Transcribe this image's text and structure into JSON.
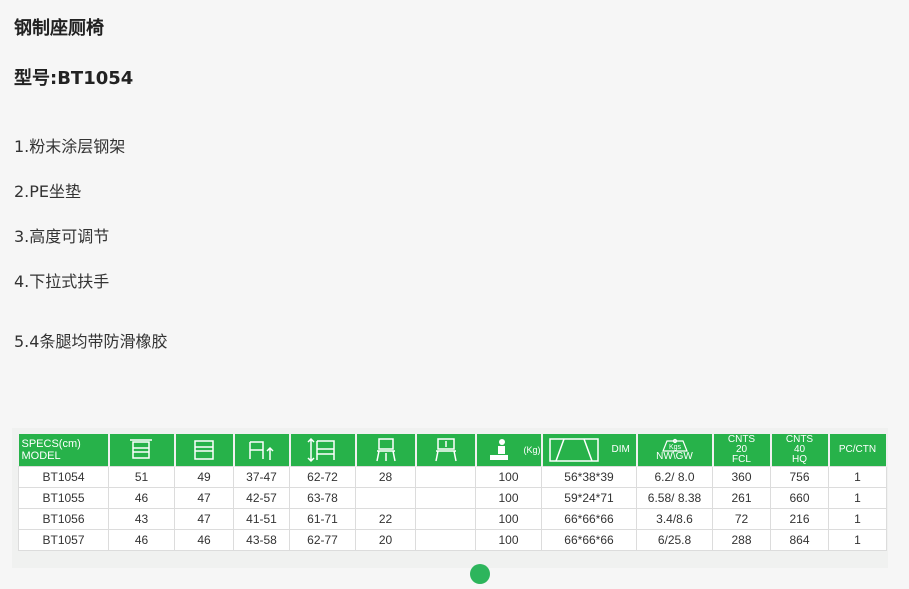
{
  "product": {
    "title": "钢制座厕椅",
    "model_line": "型号:BT1054"
  },
  "features": [
    "1.粉末涂层钢架",
    "2.PE坐垫",
    "3.高度可调节",
    "4.下拉式扶手",
    "5.4条腿均带防滑橡胶"
  ],
  "spec_table": {
    "header": {
      "label_top": "SPECS(cm)",
      "label_bottom": "MODEL",
      "capacity_unit": "(Kg)",
      "dim": "DIM",
      "nwgw_unit": "Kgs",
      "nwgw": "NW\\GW",
      "cnts20_line1": "CNTS",
      "cnts20_line2": "20",
      "cnts20_line3": "FCL",
      "cnts40_line1": "CNTS",
      "cnts40_line2": "40",
      "cnts40_line3": "HQ",
      "pcctn": "PC/CTN"
    },
    "icons": [
      "overall-width-icon",
      "seat-width-icon",
      "seat-height-icon",
      "overall-height-icon",
      "chair-icon",
      "seat-frame-icon",
      "weight-capacity-icon",
      "carton-dim-icon",
      "weight-icon"
    ],
    "rows": [
      [
        "BT1054",
        "51",
        "49",
        "37-47",
        "62-72",
        "28",
        "",
        "100",
        "56*38*39",
        "6.2/ 8.0",
        "360",
        "756",
        "1"
      ],
      [
        "BT1055",
        "46",
        "47",
        "42-57",
        "63-78",
        "",
        "",
        "100",
        "59*24*71",
        "6.58/ 8.38",
        "261",
        "660",
        "1"
      ],
      [
        "BT1056",
        "43",
        "47",
        "41-51",
        "61-71",
        "22",
        "",
        "100",
        "66*66*66",
        "3.4/8.6",
        "72",
        "216",
        "1"
      ],
      [
        "BT1057",
        "46",
        "46",
        "43-58",
        "62-77",
        "20",
        "",
        "100",
        "66*66*66",
        "6/25.8",
        "288",
        "864",
        "1"
      ]
    ]
  },
  "colors": {
    "header_green": "#27b24a",
    "background": "#f6f6f6"
  }
}
